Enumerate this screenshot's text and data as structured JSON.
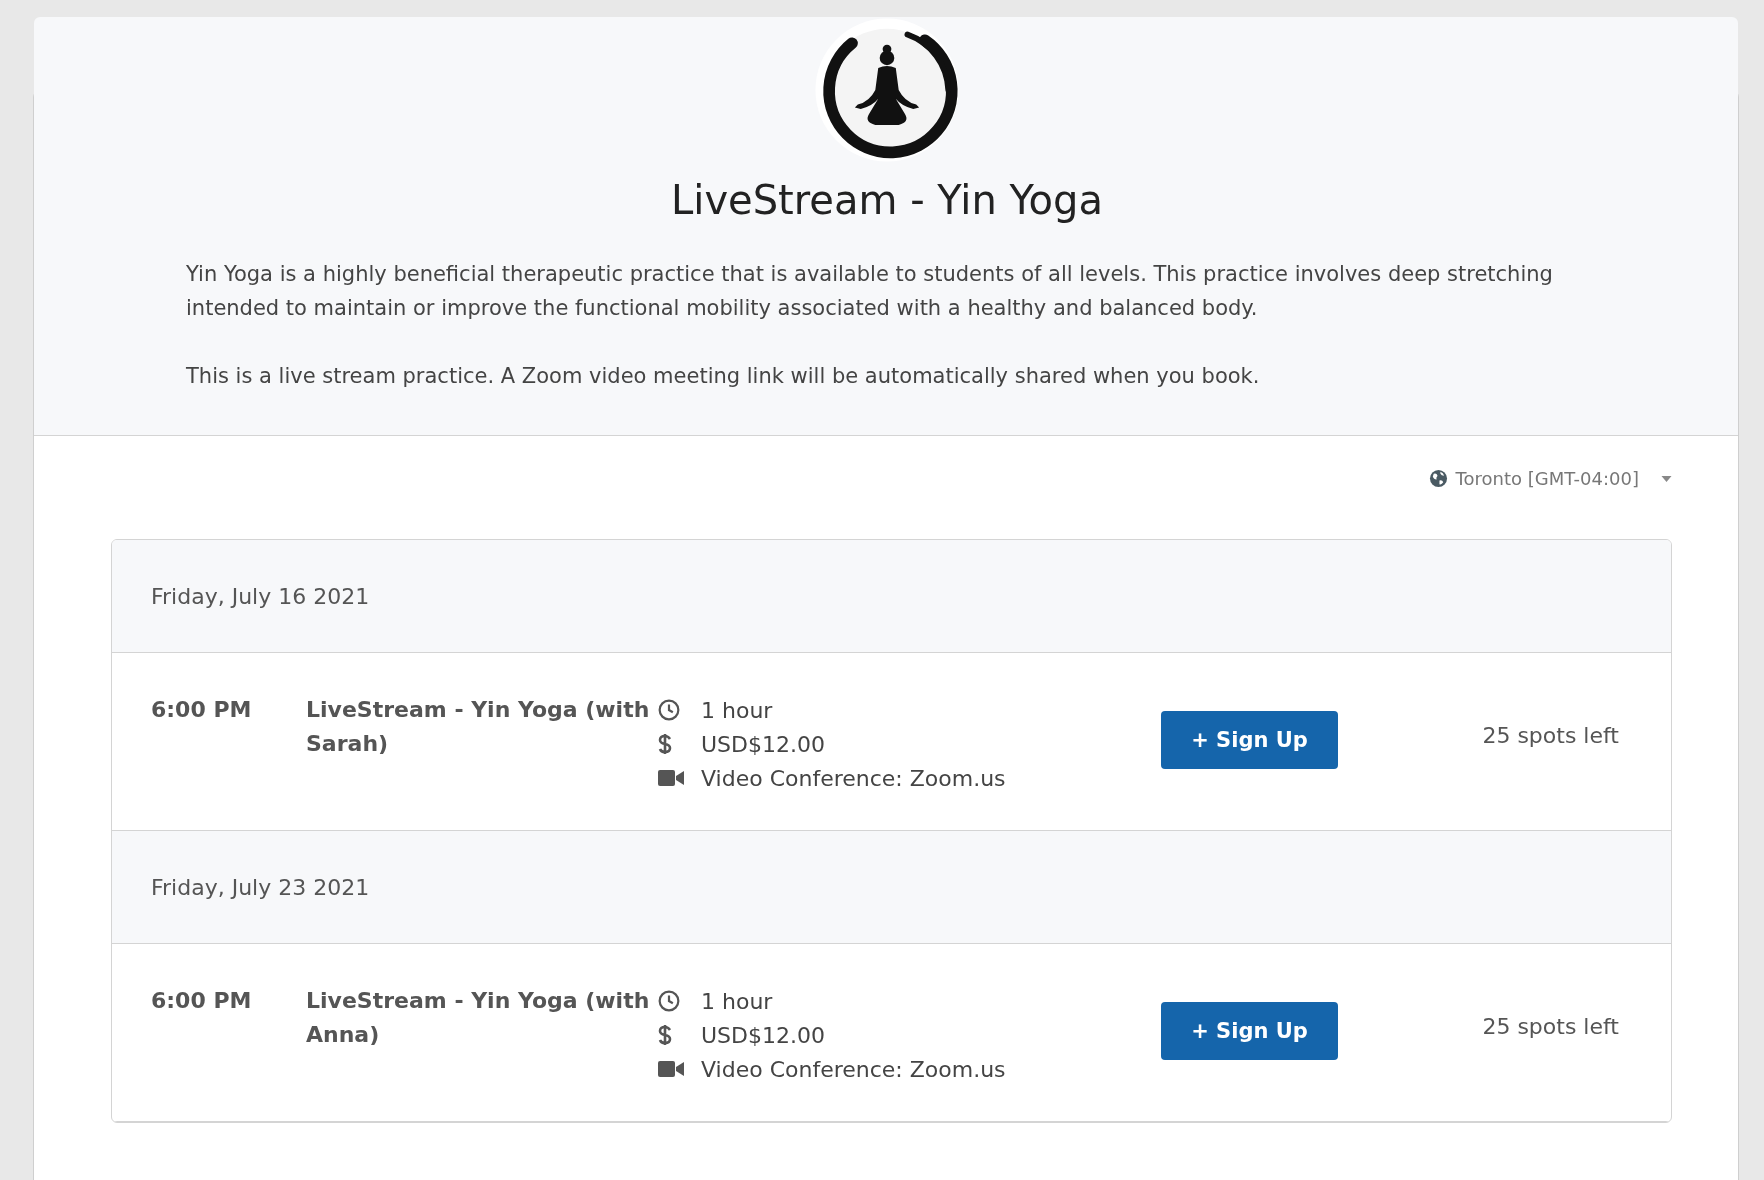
{
  "header": {
    "title": "LiveStream - Yin Yoga",
    "paragraphs": [
      "Yin Yoga is a highly beneficial therapeutic practice that is available to students of all levels. This practice involves deep stretching intended to maintain or improve the functional mobility associated with a healthy and balanced body.",
      "This is a live stream practice. A Zoom video meeting link will be automatically shared when you book."
    ]
  },
  "timezone": {
    "label": "Toronto [GMT-04:00]"
  },
  "days": [
    {
      "date": "Friday, July 16 2021",
      "events": [
        {
          "time": "6:00 PM",
          "name": "LiveStream - Yin Yoga (with Sarah)",
          "duration": "1 hour",
          "price": "USD$12.00",
          "location": "Video Conference: Zoom.us",
          "button": "+ Sign Up",
          "spots": "25 spots left"
        }
      ]
    },
    {
      "date": "Friday, July 23 2021",
      "events": [
        {
          "time": "6:00 PM",
          "name": "LiveStream - Yin Yoga (with Anna)",
          "duration": "1 hour",
          "price": "USD$12.00",
          "location": "Video Conference: Zoom.us",
          "button": "+ Sign Up",
          "spots": "25 spots left"
        }
      ]
    }
  ]
}
